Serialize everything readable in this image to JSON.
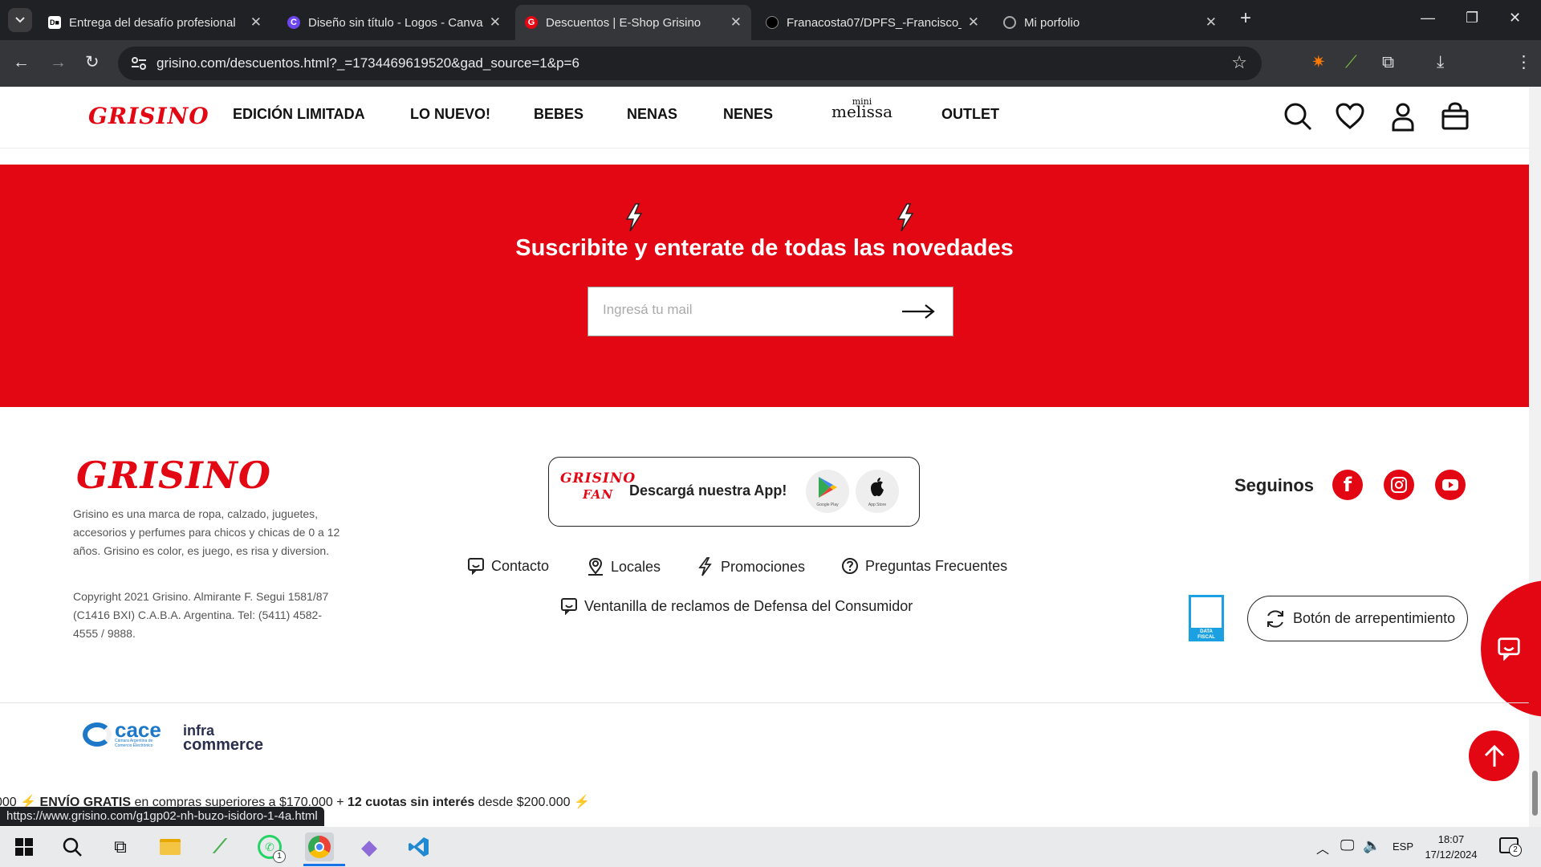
{
  "browser": {
    "tabs": [
      {
        "title": "Entrega del desafío profesional",
        "active": false
      },
      {
        "title": "Diseño sin título - Logos - Canva",
        "active": false
      },
      {
        "title": "Descuentos | E-Shop Grisino",
        "active": true
      },
      {
        "title": "Franacosta07/DPFS_-Francisco_",
        "active": false
      },
      {
        "title": "Mi porfolio",
        "active": false
      }
    ],
    "url": "grisino.com/descuentos.html?_=1734469619520&gad_source=1&p=6"
  },
  "site": {
    "logo": "GRISINO",
    "nav": [
      "EDICIÓN LIMITADA",
      "LO NUEVO!",
      "BEBES",
      "NENAS",
      "NENES",
      "OUTLET"
    ],
    "nav_melissa_top": "mini",
    "nav_melissa_bottom": "melissa",
    "newsletter": {
      "title": "Suscribite y enterate de todas las novedades",
      "placeholder": "Ingresá tu mail"
    },
    "footer": {
      "logo": "GRISINO",
      "description": "Grisino es una marca de ropa, calzado, juguetes, accesorios y perfumes para chicos y chicas de 0 a 12 años. Grisino es color, es juego, es risa y diversion.",
      "copyright": "Copyright 2021 Grisino. Almirante F. Segui 1581/87 (C1416 BXI) C.A.B.A. Argentina. Tel: (5411) 4582-4555 / 9888.",
      "app_logo_top": "GRISINO",
      "app_logo_bottom": "FAN",
      "app_text": "Descargá nuestra App!",
      "google_play": "Google Play",
      "app_store": "App Store",
      "links": [
        "Contacto",
        "Locales",
        "Promociones",
        "Preguntas Frecuentes"
      ],
      "consumer_link": "Ventanilla de reclamos de Defensa del Consumidor",
      "follow": "Seguinos",
      "withdraw_button": "Botón de arrepentimiento",
      "data_fiscal": "DATA FISCAL",
      "cace": "cace",
      "cace_sub": "Cámara Argentina de Comercio Electrónico",
      "infra_top": "infra",
      "infra_bottom": "commerce"
    },
    "ticker": {
      "prefix": "000",
      "free_ship": "ENVÍO GRATIS",
      "free_ship_rest": " en compras superiores a $170.000 + ",
      "installments": "12 cuotas sin interés",
      "installments_rest": " desde $200.000"
    },
    "status_url": "https://www.grisino.com/g1gp02-nh-buzo-isidoro-1-4a.html"
  },
  "taskbar": {
    "lang": "ESP",
    "time": "18:07",
    "date": "17/12/2024",
    "whatsapp_badge": "1",
    "notif_badge": "2"
  },
  "colors": {
    "brand_red": "#e30613",
    "chrome_dark": "#202124",
    "chrome_toolbar": "#35363a"
  }
}
